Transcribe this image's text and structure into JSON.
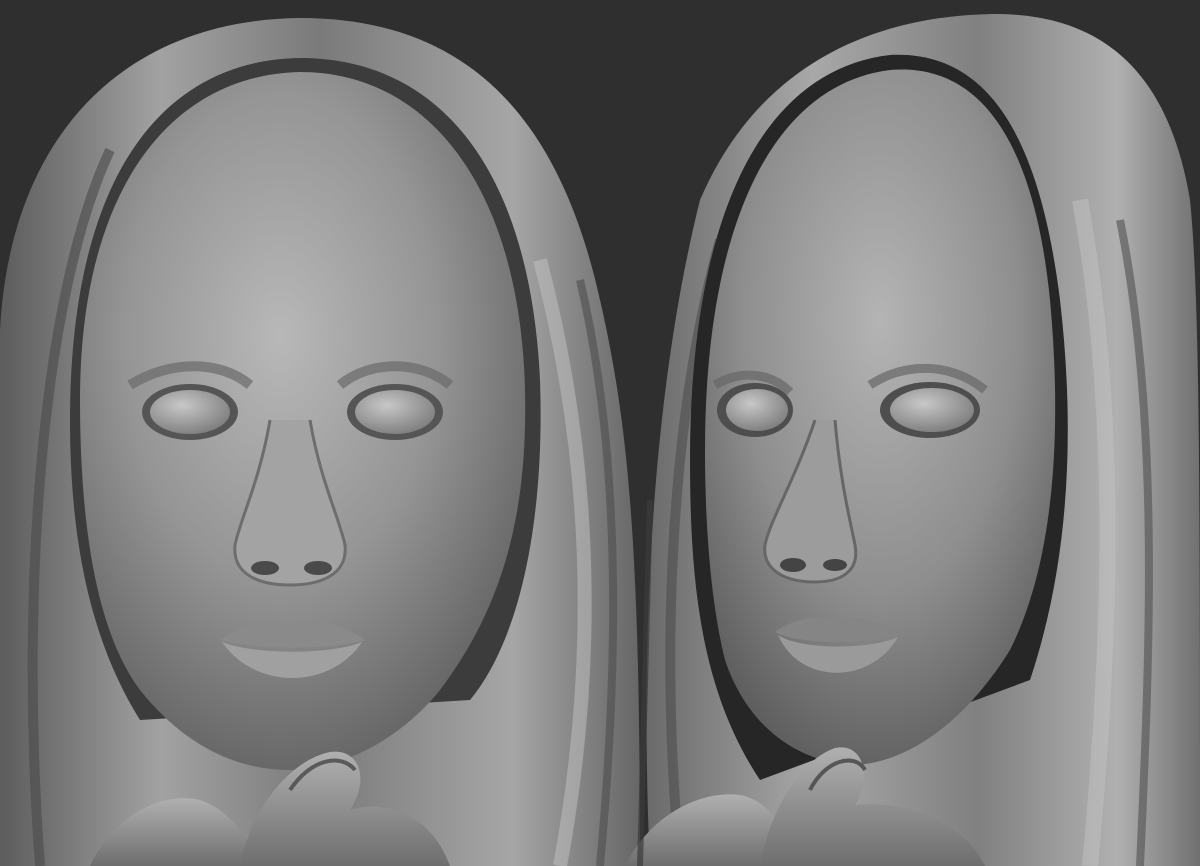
{
  "scene": {
    "background_color": "#2f2f2f",
    "material_color": "#8c8c8c",
    "subject": "clay-render",
    "views": [
      {
        "name": "front-view"
      },
      {
        "name": "three-quarter-view"
      }
    ]
  }
}
